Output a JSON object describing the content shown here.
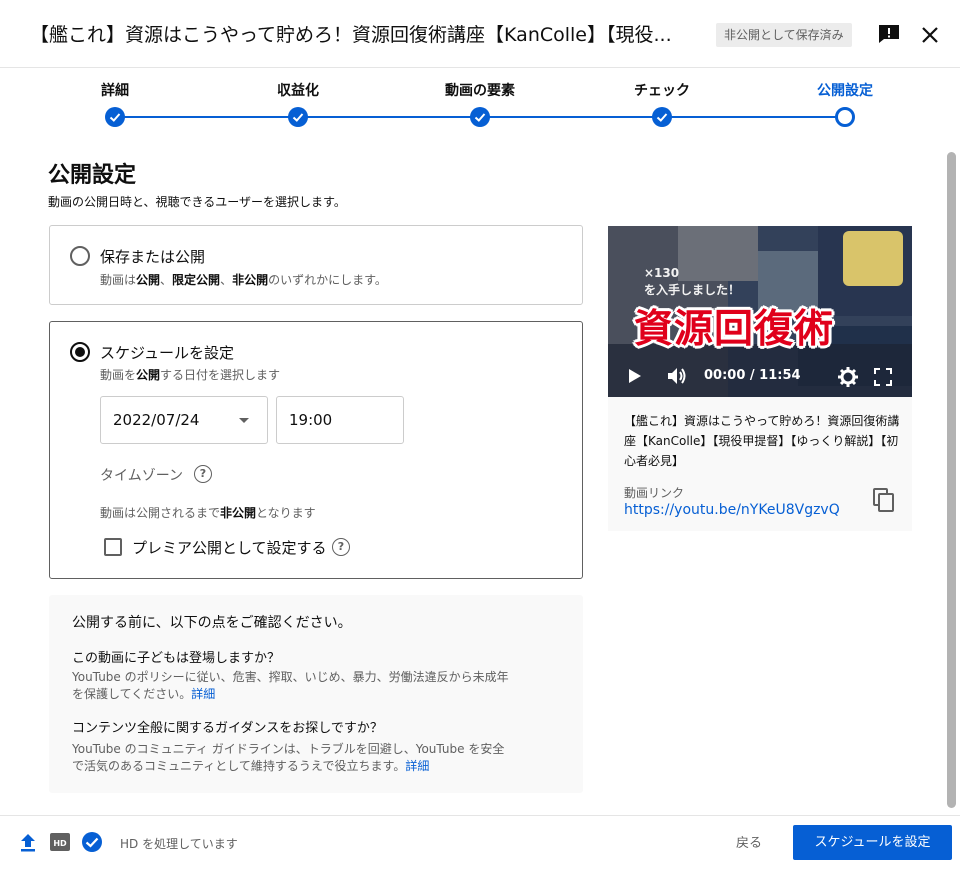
{
  "header": {
    "title": "【艦これ】資源はこうやって貯めろ！資源回復術講座【KanColle】【現役...",
    "saved_badge": "非公開として保存済み",
    "feedback_icon": "feedback-icon",
    "close_icon": "close-icon"
  },
  "stepper": {
    "steps": [
      {
        "label": "詳細",
        "state": "done"
      },
      {
        "label": "収益化",
        "state": "done"
      },
      {
        "label": "動画の要素",
        "state": "done"
      },
      {
        "label": "チェック",
        "state": "done"
      },
      {
        "label": "公開設定",
        "state": "current"
      }
    ]
  },
  "main": {
    "title": "公開設定",
    "description": "動画の公開日時と、視聴できるユーザーを選択します。",
    "save_option": {
      "title": "保存または公開",
      "sub_prefix": "動画は",
      "sub_public": "公開",
      "sub_sep1": "、",
      "sub_unlisted": "限定公開",
      "sub_sep2": "、",
      "sub_private": "非公開",
      "sub_suffix": "のいずれかにします。"
    },
    "schedule_option": {
      "title": "スケジュールを設定",
      "sub_prefix": "動画を",
      "sub_bold": "公開",
      "sub_suffix": "する日付を選択します",
      "date_value": "2022/07/24",
      "time_value": "19:00",
      "timezone_label": "タイムゾーン",
      "private_note_prefix": "動画は公開されるまで",
      "private_note_bold": "非公開",
      "private_note_suffix": "となります",
      "premiere_label": "プレミア公開として設定する"
    },
    "info": {
      "title": "公開する前に、以下の点をご確認ください。",
      "q1": "この動画に子どもは登場しますか？",
      "d1": "YouTube のポリシーに従い、危害、搾取、いじめ、暴力、労働法違反から未成年を保護してください。",
      "d1_link": "詳細",
      "q2": "コンテンツ全般に関するガイダンスをお探しですか？",
      "d2": "YouTube のコミュニティ ガイドラインは、トラブルを回避し、YouTube を安全で活気のあるコミュニティとして維持するうえで役立ちます。",
      "d2_link": "詳細"
    }
  },
  "preview": {
    "thumb_overlay_text": "資源回復術",
    "thumb_small_text1": "×130",
    "thumb_small_text2": "を入手しました！",
    "time_display": "00:00 / 11:54",
    "video_title": "【艦これ】資源はこうやって貯めろ！資源回復術講座【KanColle】【現役甲提督】【ゆっくり解説】【初心者必見】",
    "link_label": "動画リンク",
    "link_url": "https://youtu.be/nYKeU8VgzvQ"
  },
  "footer": {
    "status": "HD を処理しています",
    "back": "戻る",
    "primary": "スケジュールを設定"
  },
  "colors": {
    "accent": "#065fd4",
    "thumb_red": "#e0001b"
  }
}
